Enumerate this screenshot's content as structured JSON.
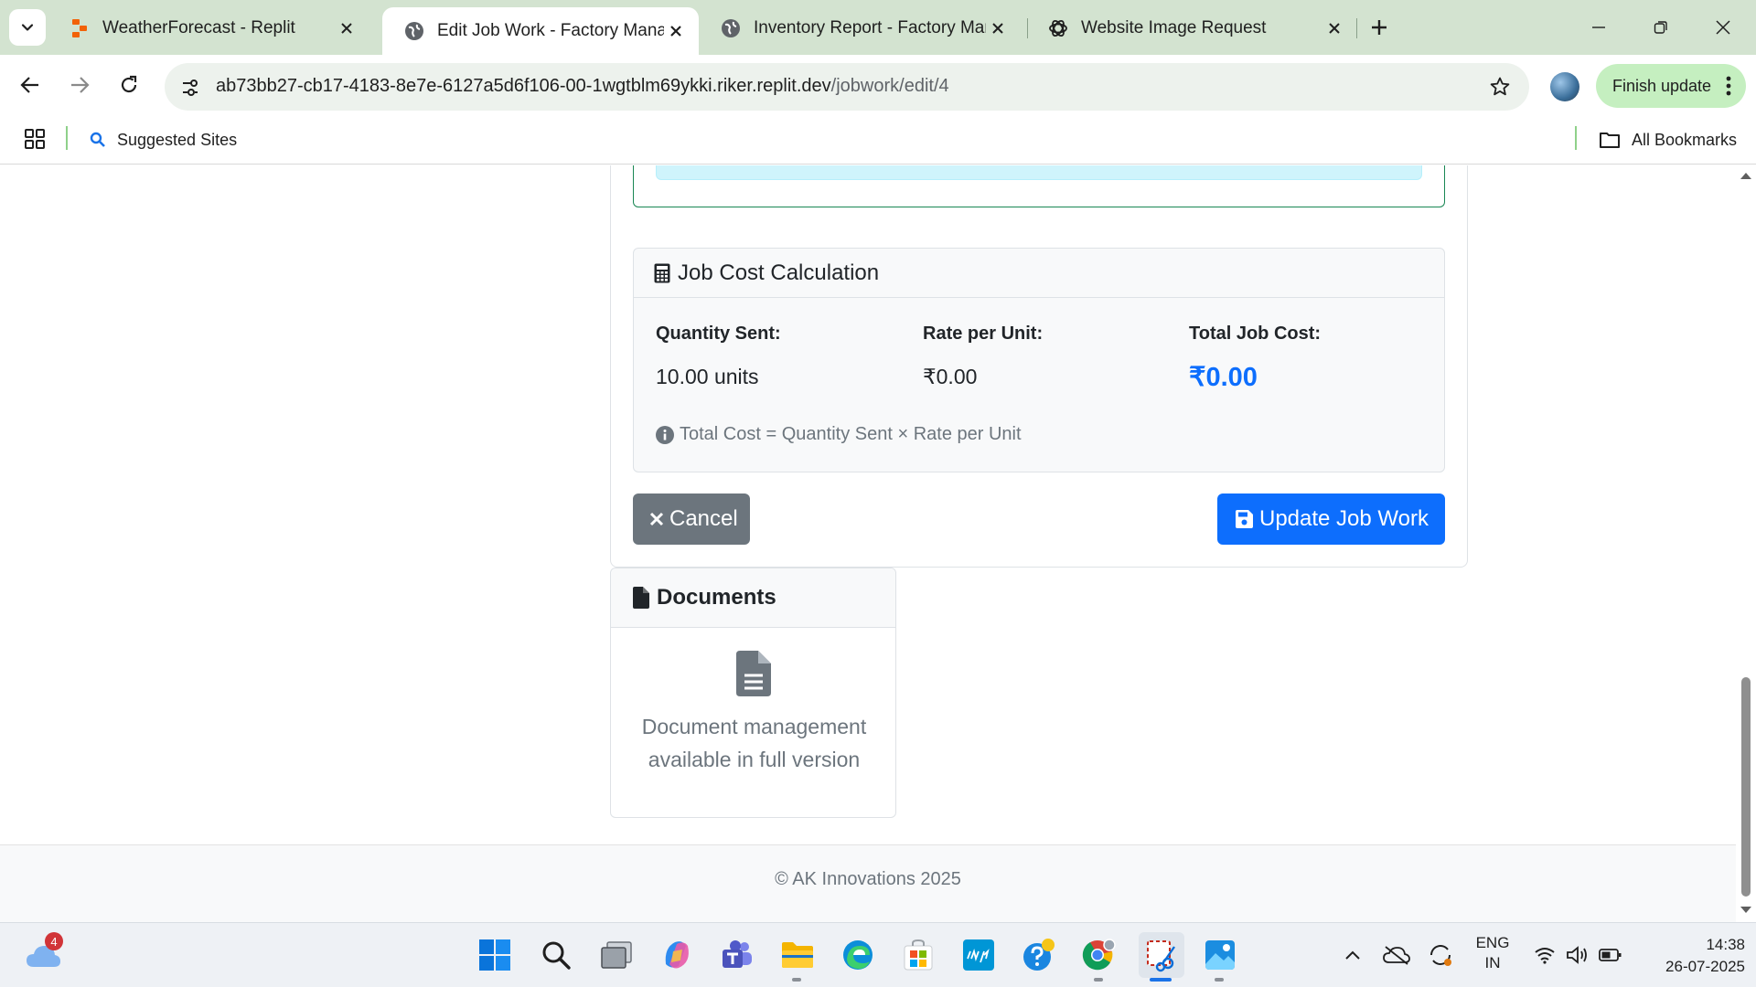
{
  "browser": {
    "tabs": [
      {
        "title": "WeatherForecast - Replit",
        "favicon": "replit-icon",
        "active": false
      },
      {
        "title": "Edit Job Work - Factory Manage",
        "favicon": "globe-icon",
        "active": true
      },
      {
        "title": "Inventory Report - Factory Man",
        "favicon": "globe-icon",
        "active": false
      },
      {
        "title": "Website Image Request",
        "favicon": "chatgpt-icon",
        "active": false
      }
    ],
    "url_host": "ab73bb27-cb17-4183-8e7e-6127a5d6f106-00-1wgtblm69ykki.riker.replit.dev",
    "url_path": "/jobwork/edit/4",
    "finish_update_label": "Finish update",
    "bookmarks": {
      "suggested_sites": "Suggested Sites",
      "all_bookmarks": "All Bookmarks"
    }
  },
  "page": {
    "cost_card": {
      "title": "Job Cost Calculation",
      "quantity_label": "Quantity Sent:",
      "quantity_value": "10.00 units",
      "rate_label": "Rate per Unit:",
      "rate_value": "₹0.00",
      "total_label": "Total Job Cost:",
      "total_value": "₹0.00",
      "formula_note": "Total Cost = Quantity Sent × Rate per Unit"
    },
    "buttons": {
      "cancel": "Cancel",
      "update": "Update Job Work"
    },
    "documents": {
      "title": "Documents",
      "message_line1": "Document management",
      "message_line2": "available in full version"
    },
    "footer": "© AK Innovations 2025"
  },
  "taskbar": {
    "weather_badge": "4",
    "language_line1": "ENG",
    "language_line2": "IN",
    "time": "14:38",
    "date": "26-07-2025"
  },
  "colors": {
    "primary": "#0d6efd",
    "secondary": "#6c757d",
    "tabbar": "#d3e3d0",
    "finish_update": "#c5efc0"
  }
}
